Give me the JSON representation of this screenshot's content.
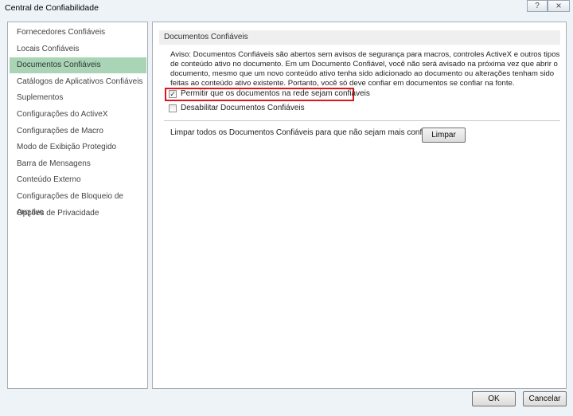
{
  "window": {
    "title": "Central de Confiabilidade",
    "help_icon": "?",
    "close_icon": "×"
  },
  "sidebar": {
    "items": [
      {
        "label": "Fornecedores Confiáveis"
      },
      {
        "label": "Locais Confiáveis"
      },
      {
        "label": "Documentos Confiáveis",
        "selected": true
      },
      {
        "label": "Catálogos de Aplicativos Confiáveis"
      },
      {
        "label": "Suplementos"
      },
      {
        "label": "Configurações do ActiveX"
      },
      {
        "label": "Configurações de Macro"
      },
      {
        "label": "Modo de Exibição Protegido"
      },
      {
        "label": "Barra de Mensagens"
      },
      {
        "label": "Conteúdo Externo"
      },
      {
        "label": "Configurações de Bloqueio de Arquivo"
      },
      {
        "label": "Opções de Privacidade"
      }
    ]
  },
  "main": {
    "header": "Documentos Confiáveis",
    "warning": "Aviso: Documentos Confiáveis são abertos sem avisos de segurança para macros, controles ActiveX e outros tipos de conteúdo ativo no documento. Em um Documento Confiável, você não será avisado na próxima vez que abrir o documento, mesmo que um novo conteúdo ativo tenha sido adicionado ao documento ou alterações tenham sido feitas ao conteúdo ativo existente. Portanto, você só deve confiar em documentos se confiar na fonte.",
    "allow_network": {
      "label": "Permitir que os documentos na rede sejam confiáveis",
      "checked": true
    },
    "disable": {
      "label": "Desabilitar Documentos Confiáveis",
      "checked": false
    },
    "clear_text": "Limpar todos os Documentos Confiáveis para que não sejam mais confiáveis",
    "clear_button": "Limpar",
    "highlight_color": "#e0141e",
    "selected_color": "#a9d5b6"
  },
  "footer": {
    "ok": "OK",
    "cancel": "Cancelar"
  }
}
